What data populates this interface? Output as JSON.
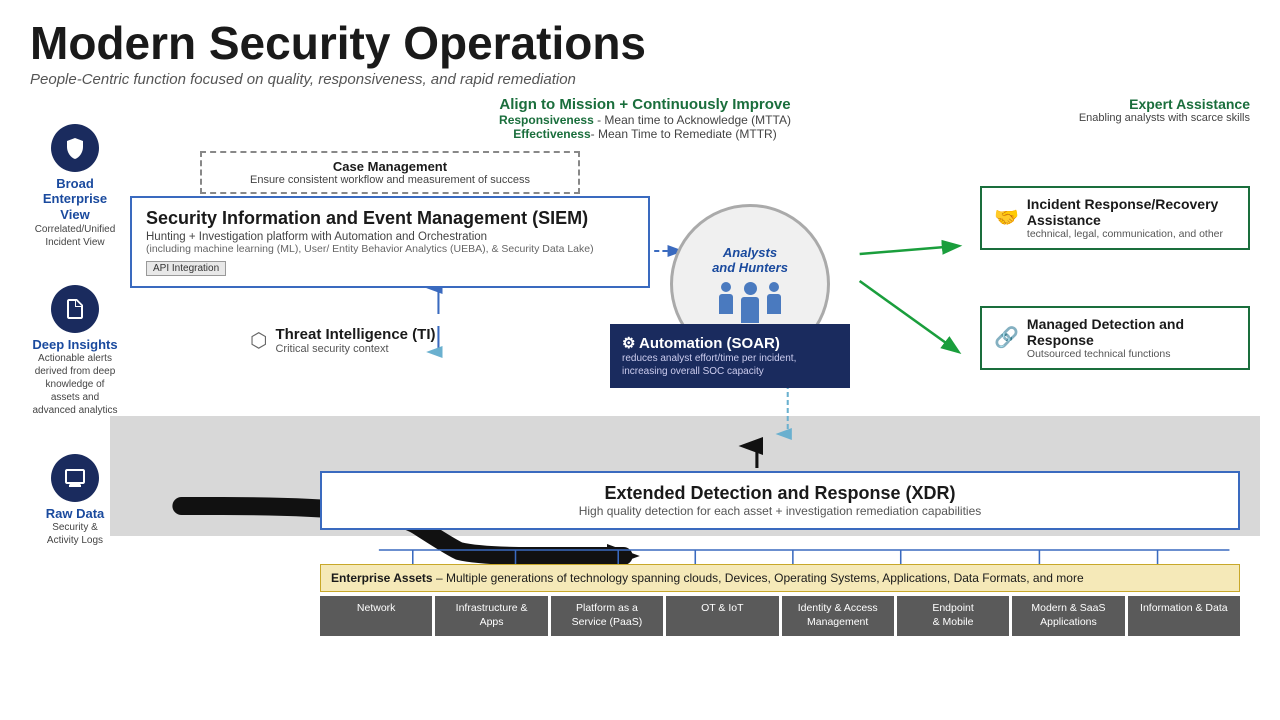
{
  "page": {
    "title": "Modern Security Operations",
    "subtitle": "People-Centric function focused on quality, responsiveness,  and rapid remediation"
  },
  "sidebar": {
    "items": [
      {
        "id": "broad-enterprise",
        "label": "Broad Enterprise View",
        "sublabel": "Correlated/Unified\nIncident View",
        "icon": "shield"
      },
      {
        "id": "deep-insights",
        "label": "Deep Insights",
        "sublabel": "Actionable alerts derived from deep\nknowledge of assets and advanced analytics",
        "icon": "document"
      },
      {
        "id": "raw-data",
        "label": "Raw Data",
        "sublabel": "Security &\nActivity Logs",
        "icon": "monitor"
      }
    ]
  },
  "align_section": {
    "title": "Align to Mission + Continuously Improve",
    "line1_label": "Responsiveness",
    "line1_text": "- Mean time to Acknowledge (MTTA)",
    "line2_label": "Effectiveness",
    "line2_text": "- Mean Time to Remediate (MTTR)"
  },
  "expert_section": {
    "title": "Expert Assistance",
    "subtitle": "Enabling analysts with scarce skills"
  },
  "case_management": {
    "title": "Case Management",
    "subtitle": "Ensure consistent workflow and measurement of success"
  },
  "siem": {
    "title": "Security Information and Event Management (SIEM)",
    "sub1": "Hunting + Investigation platform with Automation and Orchestration",
    "sub2": "(including machine learning (ML), User/ Entity Behavior Analytics (UEBA), & Security Data Lake)",
    "api_label": "API Integration"
  },
  "threat_intelligence": {
    "title": "Threat Intelligence (TI)",
    "subtitle": "Critical security context"
  },
  "analysts": {
    "title": "Analysts\nand Hunters"
  },
  "soar": {
    "title": "⚙ Automation (SOAR)",
    "subtitle": "reduces analyst effort/time per incident,\nincreasing overall SOC capacity"
  },
  "incident_response": {
    "title": "Incident Response/Recovery Assistance",
    "subtitle": "technical, legal, communication, and other"
  },
  "mdr": {
    "title": "Managed Detection and Response",
    "subtitle": "Outsourced technical functions"
  },
  "xdr": {
    "title": "Extended Detection and Response (XDR)",
    "subtitle": "High quality detection for each asset + investigation remediation capabilities"
  },
  "enterprise_assets": {
    "banner": "Enterprise Assets – Multiple generations of technology spanning clouds, Devices, Operating Systems, Applications, Data Formats, and more",
    "categories": [
      "Network",
      "Infrastructure & Apps",
      "Platform as a\nService (PaaS)",
      "OT & IoT",
      "Identity & Access\nManagement",
      "Endpoint\n& Mobile",
      "Modern & SaaS Applications",
      "Information & Data"
    ]
  }
}
